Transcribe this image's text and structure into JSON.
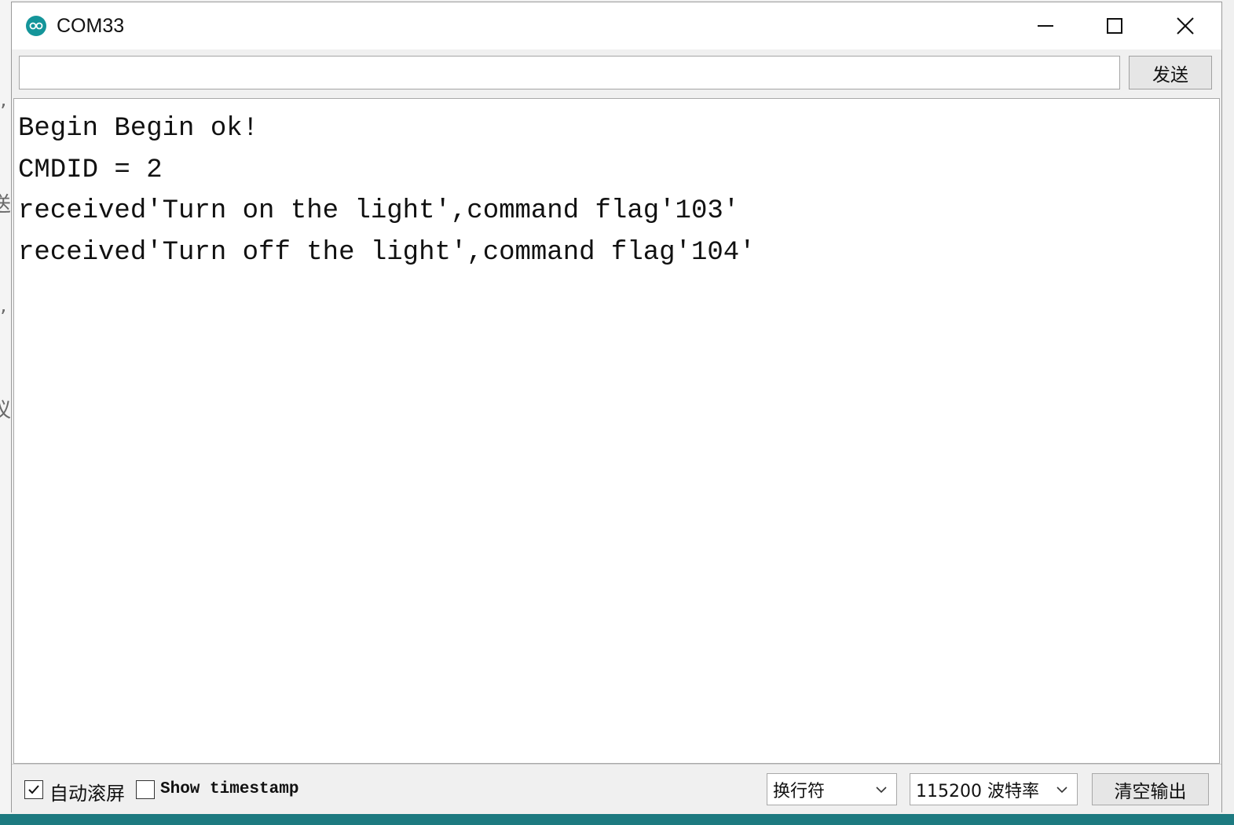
{
  "window": {
    "title": "COM33",
    "accent_color": "#14959a"
  },
  "send_bar": {
    "input_value": "",
    "send_label": "发送"
  },
  "output": {
    "lines": [
      "Begin Begin ok!",
      "CMDID = 2",
      "received'Turn on the light',command flag'103'",
      "received'Turn off the light',command flag'104'"
    ]
  },
  "bottom_bar": {
    "autoscroll_label": "自动滚屏",
    "autoscroll_checked": true,
    "timestamp_label": "Show timestamp",
    "timestamp_checked": false,
    "line_ending_value": "换行符",
    "baud_rate_value": "115200 波特率",
    "clear_label": "清空输出"
  },
  "background_edge_glyphs": [
    "ʼ",
    "送",
    "ʼ",
    "议"
  ]
}
